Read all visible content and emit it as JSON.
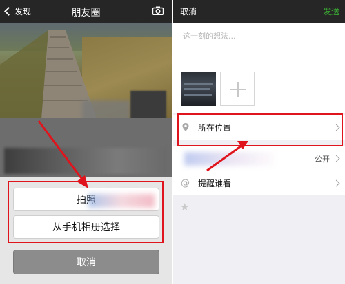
{
  "left": {
    "nav": {
      "back_label": "发现",
      "title": "朋友圈"
    },
    "icons": {
      "back": "chevron-left-icon",
      "camera": "camera-icon"
    },
    "action_sheet": {
      "take_photo": "拍照",
      "from_album": "从手机相册选择",
      "cancel": "取消"
    }
  },
  "right": {
    "header": {
      "cancel": "取消",
      "send": "发送"
    },
    "compose": {
      "placeholder": "这一刻的想法..."
    },
    "rows": {
      "location": {
        "label": "所在位置",
        "icon": "location-pin-icon"
      },
      "visibility": {
        "value": "公开"
      },
      "remind": {
        "label": "提醒谁看",
        "icon": "at-icon"
      }
    },
    "star_icon": "star-icon"
  },
  "colors": {
    "highlight": "#e0141c",
    "send_green": "#3aa533",
    "header_bg": "#262626"
  }
}
